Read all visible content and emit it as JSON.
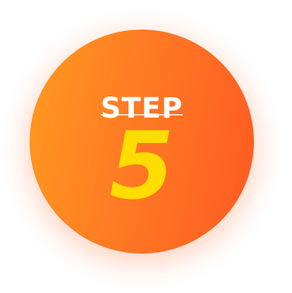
{
  "badge": {
    "label": "STEP",
    "number": "5",
    "colors": {
      "gradient_start": "#ff9a1f",
      "gradient_end": "#ff5a22",
      "label": "#ffffff",
      "number": "#ffdd00"
    }
  }
}
